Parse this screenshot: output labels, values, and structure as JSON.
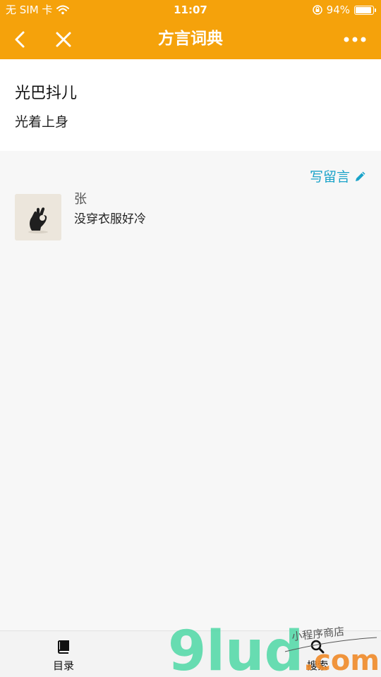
{
  "status_bar": {
    "carrier": "无 SIM 卡",
    "time": "11:07",
    "battery": "94%",
    "battery_level": 0.94
  },
  "nav": {
    "title": "方言词典",
    "back_icon": "chevron-left-icon",
    "close_icon": "close-icon",
    "more_icon": "more-icon"
  },
  "entry": {
    "word": "光巴抖儿",
    "meaning": "光着上身"
  },
  "comments": {
    "write_label": "写留言",
    "write_icon": "pencil-icon",
    "items": [
      {
        "name": "张",
        "text": "没穿衣服好冷",
        "avatar_icon": "ok-hand-avatar"
      }
    ]
  },
  "tabbar": {
    "items": [
      {
        "label": "目录",
        "icon": "book-icon"
      },
      {
        "label": "搜索",
        "icon": "search-icon"
      }
    ]
  },
  "watermark": {
    "text": "9lud.com",
    "subtext": "小程序商店"
  },
  "colors": {
    "accent": "#f5a20b",
    "link": "#1aa3c9"
  }
}
